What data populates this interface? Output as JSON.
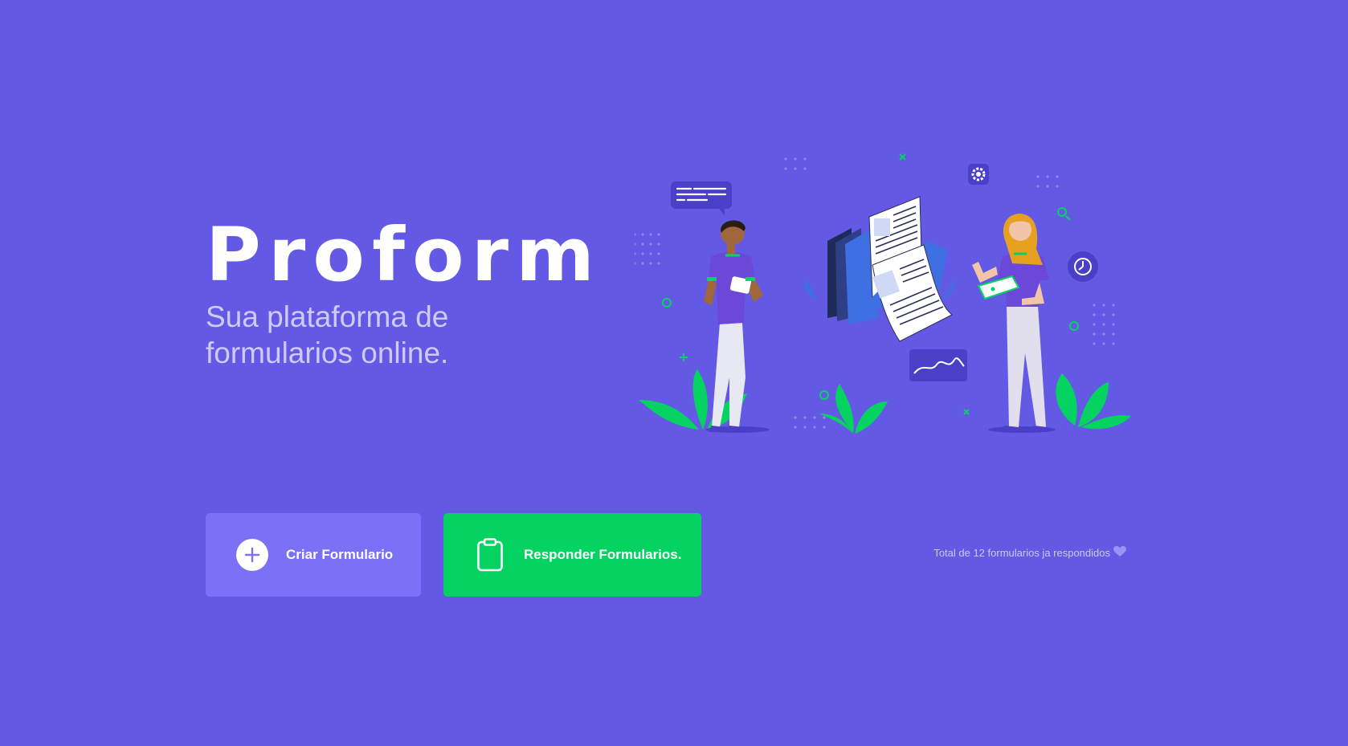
{
  "hero": {
    "title": "Proform",
    "tagline": "Sua plataforma de formularios online."
  },
  "actions": {
    "create_label": "Criar Formulario",
    "respond_label": "Responder Formularios."
  },
  "footer": {
    "total_text": "Total de 12 formularios ja respondidos",
    "heart_icon": "purple-heart-icon"
  },
  "colors": {
    "background": "#6359E4",
    "create_button": "#7C70F6",
    "respond_button": "#04D361",
    "accent_green": "#04D361"
  }
}
